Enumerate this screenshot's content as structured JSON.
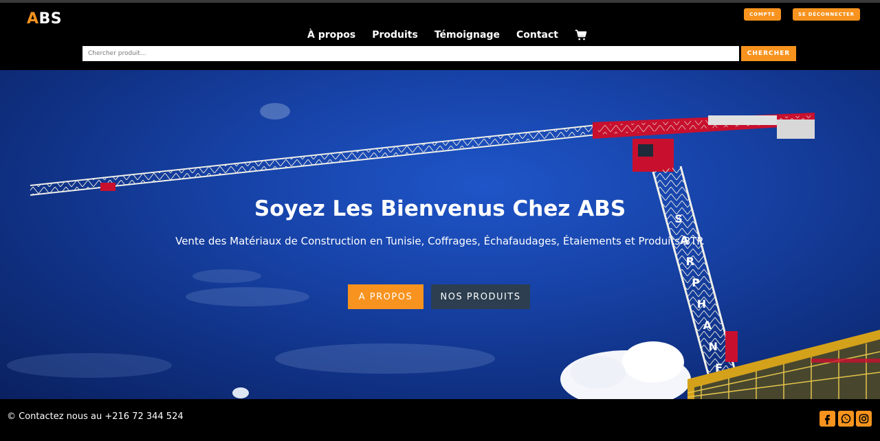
{
  "logo": {
    "first": "A",
    "rest": "BS"
  },
  "account": {
    "compte": "COMPTE",
    "logout": "SE DÉCONNECTER"
  },
  "nav": {
    "about": "À propos",
    "products": "Produits",
    "testimonials": "Témoignage",
    "contact": "Contact"
  },
  "search": {
    "placeholder": "Chercher produit...",
    "button": "CHERCHER"
  },
  "hero": {
    "title": "Soyez Les Bienvenus Chez ABS",
    "subtitle": "Vente des Matériaux de Construction en Tunisie, Coffrages, Échafaudages, Étaiements et Produits BTP.",
    "btn_about": "A PROPOS",
    "btn_products": "NOS PRODUITS",
    "crane_text": "SARPHANFIN"
  },
  "footer": {
    "contact": "© Contactez nous au +216 72 344 524"
  },
  "colors": {
    "accent": "#f7931e",
    "dark_button": "#2c3e50",
    "sky": "#1743a8"
  },
  "icons": [
    "cart-icon",
    "facebook-icon",
    "whatsapp-icon",
    "instagram-icon"
  ]
}
